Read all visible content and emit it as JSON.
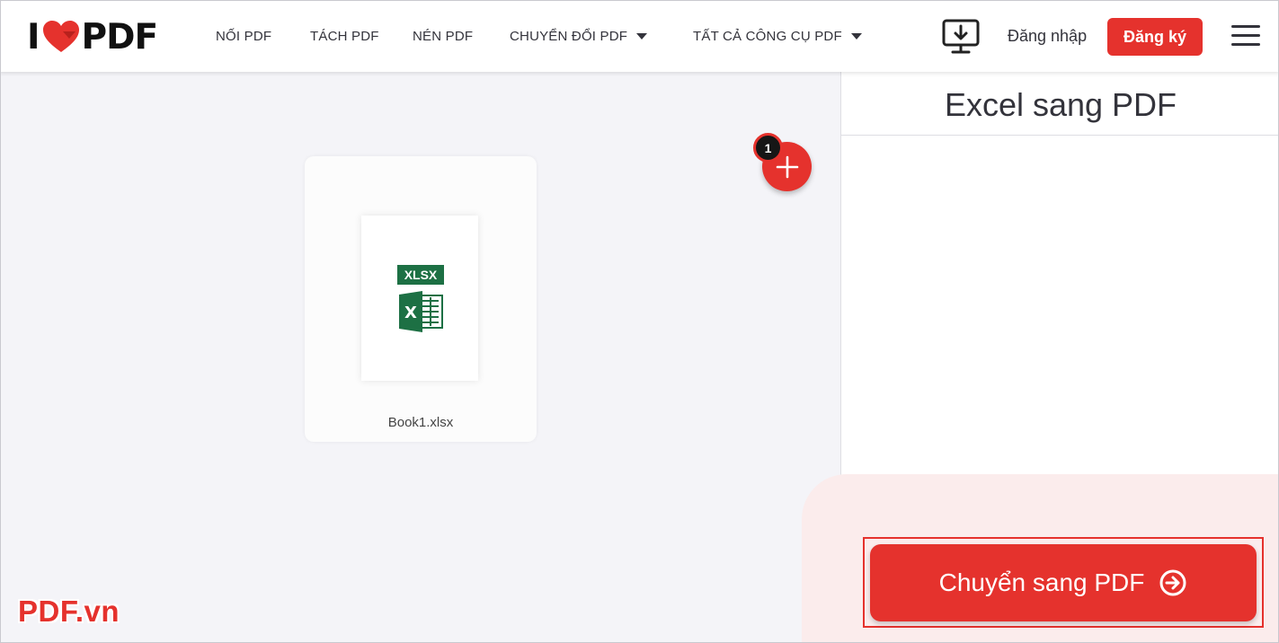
{
  "header": {
    "logo_left": "I",
    "logo_right": "PDF",
    "nav": [
      {
        "label": "NỐI PDF",
        "dropdown": false
      },
      {
        "label": "TÁCH PDF",
        "dropdown": false
      },
      {
        "label": "NÉN PDF",
        "dropdown": false
      },
      {
        "label": "CHUYỂN ĐỔI PDF",
        "dropdown": true
      },
      {
        "label": "TẤT CẢ CÔNG CỤ PDF",
        "dropdown": true
      }
    ],
    "desktop_icon": "desktop-download-icon",
    "login_label": "Đăng nhập",
    "signup_label": "Đăng ký",
    "menu_icon": "hamburger-icon"
  },
  "workspace": {
    "file": {
      "name": "Book1.xlsx",
      "type_badge": "XLSX",
      "icon": "excel-file-icon"
    },
    "file_count": "1",
    "add_icon": "plus-icon"
  },
  "sidebar": {
    "title": "Excel sang PDF",
    "convert_label": "Chuyển sang PDF",
    "convert_icon": "arrow-right-circle-icon"
  },
  "watermark": "PDF.vn",
  "colors": {
    "brand_red": "#e5322d",
    "excel_green": "#1d7044",
    "text_dark": "#33333b",
    "panel_pink": "#fbecec"
  }
}
